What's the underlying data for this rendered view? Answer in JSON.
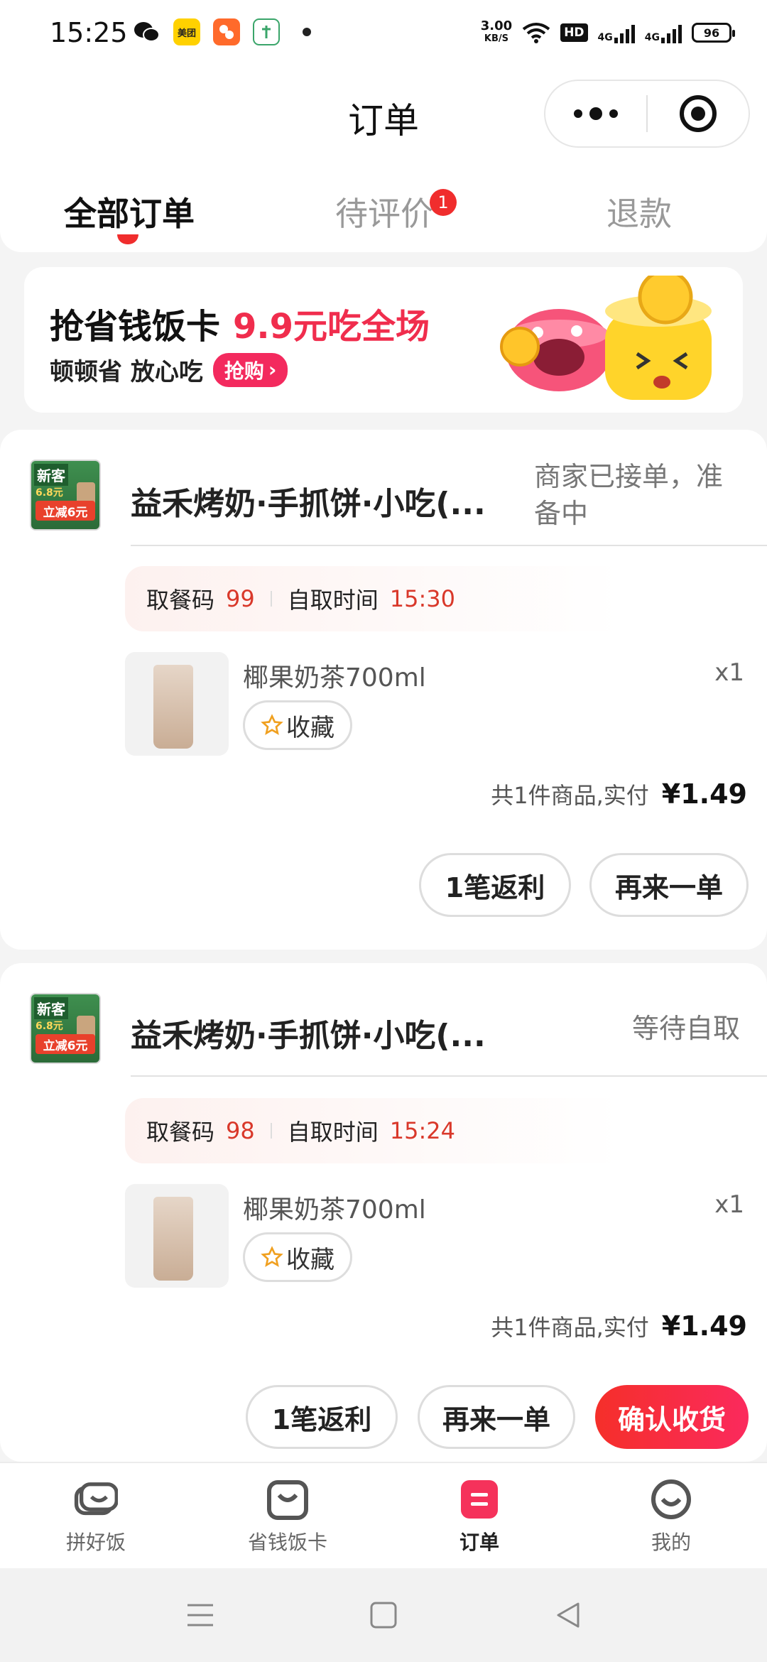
{
  "status_bar": {
    "time": "15:25",
    "apps": [
      {
        "name": "wechat-icon"
      },
      {
        "name": "meituan-icon",
        "label": "美团"
      },
      {
        "name": "app-orange-icon"
      },
      {
        "name": "app-green-icon"
      }
    ],
    "net_speed": "3.00",
    "net_unit": "KB/S",
    "hd": "HD",
    "signal1": "4G",
    "signal2": "4G",
    "battery": "96"
  },
  "header": {
    "title": "订单"
  },
  "tabs": [
    {
      "label": "全部订单",
      "active": true
    },
    {
      "label": "待评价",
      "badge": "1"
    },
    {
      "label": "退款"
    }
  ],
  "banner": {
    "title": "抢省钱饭卡",
    "highlight": "9.9元吃全场",
    "subtitle": "顿顿省 放心吃",
    "cta": "抢购"
  },
  "orders": [
    {
      "logo": {
        "tag": "新客",
        "promo": "立减6元",
        "price": "6.8元"
      },
      "shop": "益禾烤奶·手抓饼·小吃(...",
      "status": "商家已接单，准备中",
      "pickup_label": "取餐码",
      "pickup_code": "99",
      "time_label": "自取时间",
      "time": "15:30",
      "item": "椰果奶茶700ml",
      "qty": "x1",
      "fav": "收藏",
      "total_label": "共1件商品,实付",
      "total": "¥1.49",
      "buttons": [
        "1笔返利",
        "再来一单"
      ]
    },
    {
      "logo": {
        "tag": "新客",
        "promo": "立减6元",
        "price": "6.8元"
      },
      "shop": "益禾烤奶·手抓饼·小吃(...",
      "status": "等待自取",
      "pickup_label": "取餐码",
      "pickup_code": "98",
      "time_label": "自取时间",
      "time": "15:24",
      "item": "椰果奶茶700ml",
      "qty": "x1",
      "fav": "收藏",
      "total_label": "共1件商品,实付",
      "total": "¥1.49",
      "buttons": [
        "1笔返利",
        "再来一单",
        "确认收货"
      ]
    }
  ],
  "bottom_nav": [
    {
      "label": "拼好饭",
      "icon": "pinhaofan-icon"
    },
    {
      "label": "省钱饭卡",
      "icon": "fancard-icon"
    },
    {
      "label": "订单",
      "icon": "orders-icon",
      "active": true
    },
    {
      "label": "我的",
      "icon": "profile-icon"
    }
  ],
  "colors": {
    "accent": "#f02d2d",
    "brand_pink": "#f32a5e",
    "time_red": "#d9382a"
  }
}
